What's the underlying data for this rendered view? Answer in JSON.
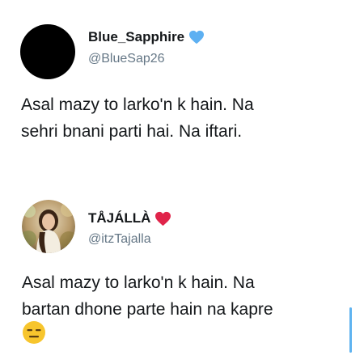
{
  "tweets": [
    {
      "name": "Blue_Sapphire",
      "handle": "@BlueSap26",
      "name_emoji": "blue-heart",
      "text_lines": [
        "Asal mazy to larko'n k hain. Na",
        "sehri bnani parti hai. Na iftari."
      ],
      "avatar": "black-circle"
    },
    {
      "name": "TÅJÁLLÀ",
      "handle": "@itzTajalla",
      "name_emoji": "red-heart",
      "text_lines": [
        "Asal mazy to larko'n k hain. Na",
        "bartan dhone parte hain na kapre"
      ],
      "trailing_emoji": "expressionless-face",
      "avatar": "woman-photo"
    }
  ],
  "colors": {
    "handle": "#657786",
    "text": "#14171a",
    "blue_heart": "#5db0f2",
    "red_heart": "#e0244a",
    "scroll_indicator": "#5fb3f0"
  }
}
